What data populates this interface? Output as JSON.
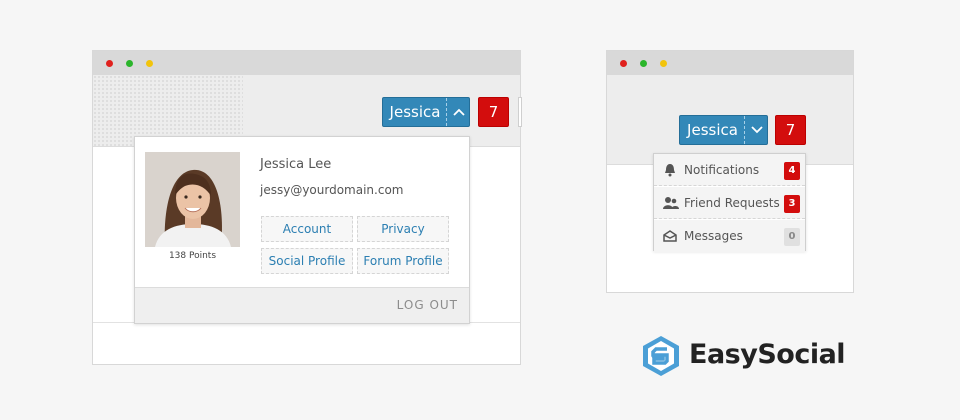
{
  "colors": {
    "accent": "#3388b8",
    "badge_red": "#d30d0d",
    "link": "#2c7fb2"
  },
  "desktop_widget": {
    "user_button": {
      "name": "Jessica",
      "caret_icon": "chevron-up-icon"
    },
    "notification_count": "7",
    "profile": {
      "full_name": "Jessica Lee",
      "email": "jessy@yourdomain.com",
      "points": "138 Points",
      "links": {
        "account": "Account",
        "privacy": "Privacy",
        "social_profile": "Social Profile",
        "forum_profile": "Forum Profile"
      },
      "logout": "LOG OUT"
    }
  },
  "compact_widget": {
    "user_button": {
      "name": "Jessica",
      "caret_icon": "chevron-down-icon"
    },
    "notification_count": "7",
    "menu": [
      {
        "label": "Notifications",
        "icon": "bell-icon",
        "count": "4"
      },
      {
        "label": "Friend Requests",
        "icon": "users-icon",
        "count": "3"
      },
      {
        "label": "Messages",
        "icon": "envelope-icon",
        "count": "0"
      }
    ]
  },
  "brand": {
    "name": "EasySocial"
  }
}
